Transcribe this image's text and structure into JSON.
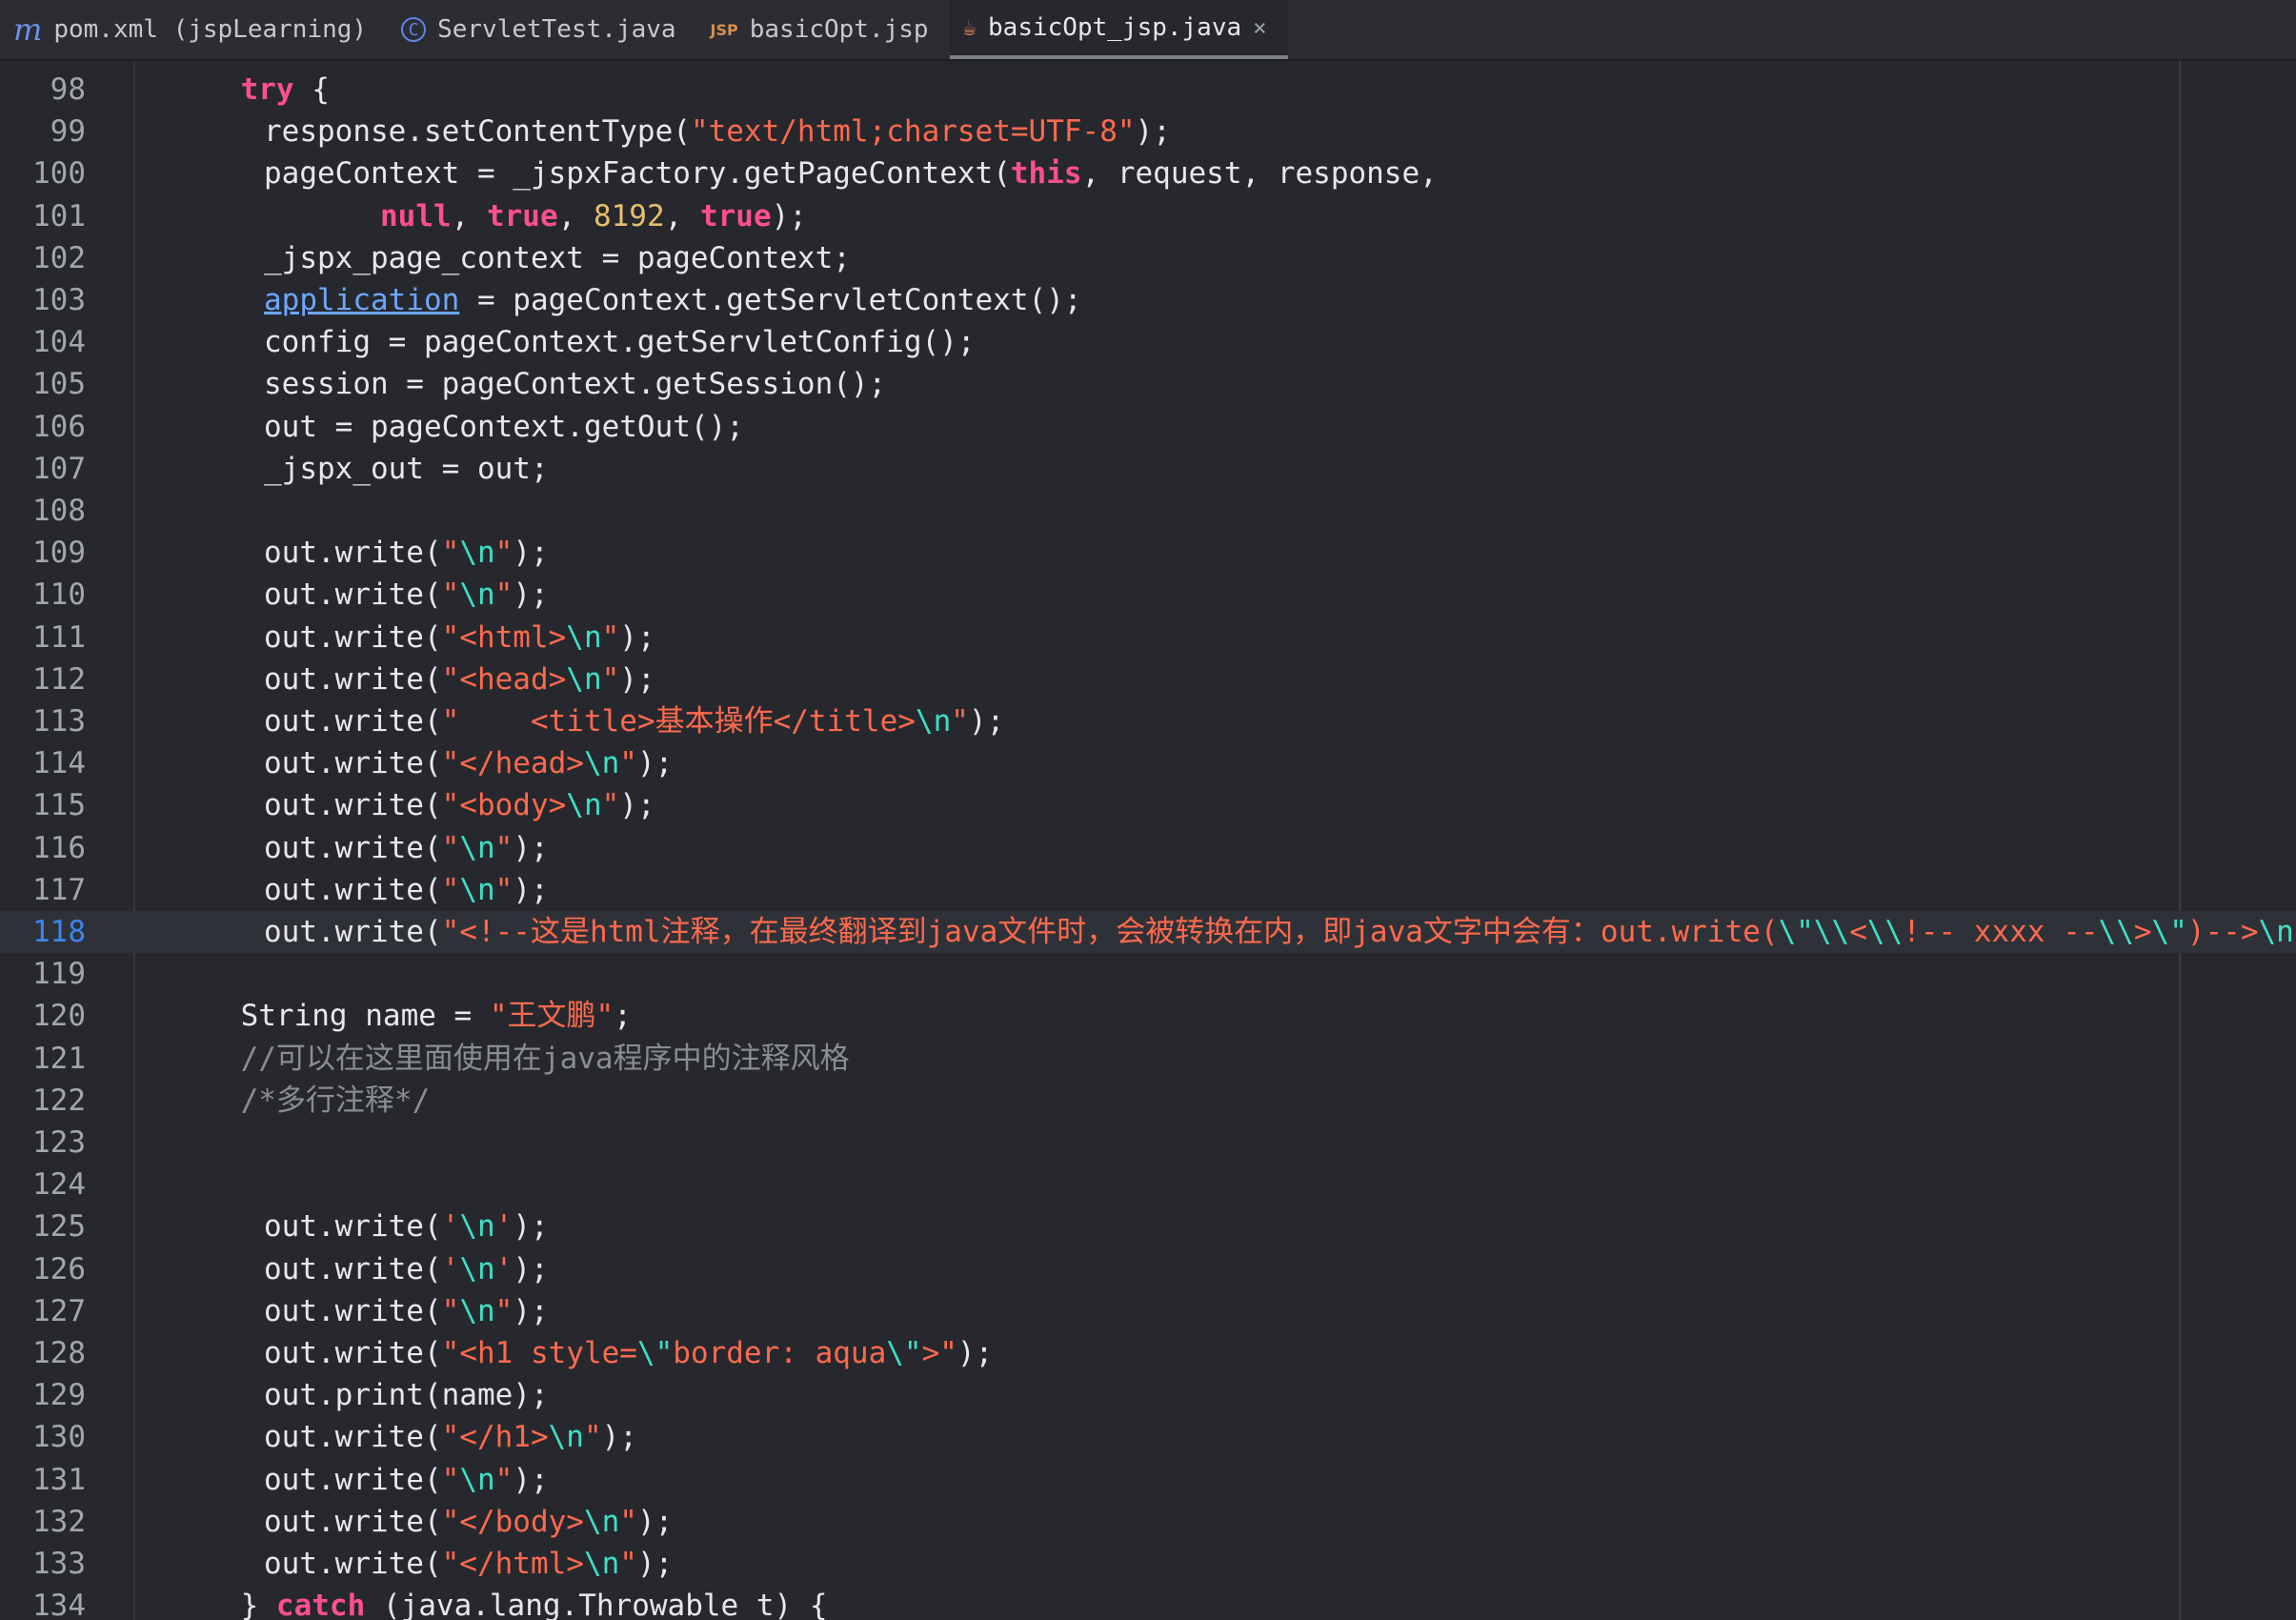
{
  "tabs": [
    {
      "icon": "maven-icon",
      "glyph": "m",
      "label": "pom.xml (jspLearning)",
      "active": false
    },
    {
      "icon": "java-class-icon",
      "glyph": "C",
      "label": "ServletTest.java",
      "active": false
    },
    {
      "icon": "jsp-file-icon",
      "glyph": "JSP",
      "label": "basicOpt.jsp",
      "active": false
    },
    {
      "icon": "java-generated-icon",
      "glyph": "☕",
      "label": "basicOpt_jsp.java",
      "active": true,
      "close_glyph": "×"
    }
  ],
  "editor": {
    "current_line": "118",
    "lines": [
      {
        "n": "98",
        "indent": 4,
        "tokens": [
          [
            "kw",
            "try"
          ],
          [
            "txt",
            " {"
          ]
        ]
      },
      {
        "n": "99",
        "indent": 5,
        "tokens": [
          [
            "txt",
            "response.setContentType("
          ],
          [
            "str",
            "\"text/html;charset=UTF-8\""
          ],
          [
            "txt",
            ");"
          ]
        ]
      },
      {
        "n": "100",
        "indent": 5,
        "tokens": [
          [
            "txt",
            "pageContext = _jspxFactory.getPageContext("
          ],
          [
            "kw",
            "this"
          ],
          [
            "txt",
            ", request, response,"
          ]
        ]
      },
      {
        "n": "101",
        "indent": 10,
        "tokens": [
          [
            "kw",
            "null"
          ],
          [
            "txt",
            ", "
          ],
          [
            "kw",
            "true"
          ],
          [
            "txt",
            ", "
          ],
          [
            "num",
            "8192"
          ],
          [
            "txt",
            ", "
          ],
          [
            "kw",
            "true"
          ],
          [
            "txt",
            ");"
          ]
        ]
      },
      {
        "n": "102",
        "indent": 5,
        "tokens": [
          [
            "txt",
            "_jspx_page_context = pageContext;"
          ]
        ]
      },
      {
        "n": "103",
        "indent": 5,
        "tokens": [
          [
            "link",
            "application"
          ],
          [
            "txt",
            " = pageContext.getServletContext();"
          ]
        ]
      },
      {
        "n": "104",
        "indent": 5,
        "tokens": [
          [
            "txt",
            "config = pageContext.getServletConfig();"
          ]
        ]
      },
      {
        "n": "105",
        "indent": 5,
        "tokens": [
          [
            "txt",
            "session = pageContext.getSession();"
          ]
        ]
      },
      {
        "n": "106",
        "indent": 5,
        "tokens": [
          [
            "txt",
            "out = pageContext.getOut();"
          ]
        ]
      },
      {
        "n": "107",
        "indent": 5,
        "tokens": [
          [
            "txt",
            "_jspx_out = out;"
          ]
        ]
      },
      {
        "n": "108",
        "indent": 0,
        "tokens": []
      },
      {
        "n": "109",
        "indent": 5,
        "tokens": [
          [
            "txt",
            "out.write("
          ],
          [
            "str",
            "\""
          ],
          [
            "esc",
            "\\n"
          ],
          [
            "str",
            "\""
          ],
          [
            "txt",
            ");"
          ]
        ]
      },
      {
        "n": "110",
        "indent": 5,
        "tokens": [
          [
            "txt",
            "out.write("
          ],
          [
            "str",
            "\""
          ],
          [
            "esc",
            "\\n"
          ],
          [
            "str",
            "\""
          ],
          [
            "txt",
            ");"
          ]
        ]
      },
      {
        "n": "111",
        "indent": 5,
        "tokens": [
          [
            "txt",
            "out.write("
          ],
          [
            "str",
            "\"<html>"
          ],
          [
            "esc",
            "\\n"
          ],
          [
            "str",
            "\""
          ],
          [
            "txt",
            ");"
          ]
        ]
      },
      {
        "n": "112",
        "indent": 5,
        "tokens": [
          [
            "txt",
            "out.write("
          ],
          [
            "str",
            "\"<head>"
          ],
          [
            "esc",
            "\\n"
          ],
          [
            "str",
            "\""
          ],
          [
            "txt",
            ");"
          ]
        ]
      },
      {
        "n": "113",
        "indent": 5,
        "tokens": [
          [
            "txt",
            "out.write("
          ],
          [
            "str",
            "\"    <title>基本操作</title>"
          ],
          [
            "esc",
            "\\n"
          ],
          [
            "str",
            "\""
          ],
          [
            "txt",
            ");"
          ]
        ]
      },
      {
        "n": "114",
        "indent": 5,
        "tokens": [
          [
            "txt",
            "out.write("
          ],
          [
            "str",
            "\"</head>"
          ],
          [
            "esc",
            "\\n"
          ],
          [
            "str",
            "\""
          ],
          [
            "txt",
            ");"
          ]
        ]
      },
      {
        "n": "115",
        "indent": 5,
        "tokens": [
          [
            "txt",
            "out.write("
          ],
          [
            "str",
            "\"<body>"
          ],
          [
            "esc",
            "\\n"
          ],
          [
            "str",
            "\""
          ],
          [
            "txt",
            ");"
          ]
        ]
      },
      {
        "n": "116",
        "indent": 5,
        "tokens": [
          [
            "txt",
            "out.write("
          ],
          [
            "str",
            "\""
          ],
          [
            "esc",
            "\\n"
          ],
          [
            "str",
            "\""
          ],
          [
            "txt",
            ");"
          ]
        ]
      },
      {
        "n": "117",
        "indent": 5,
        "tokens": [
          [
            "txt",
            "out.write("
          ],
          [
            "str",
            "\""
          ],
          [
            "esc",
            "\\n"
          ],
          [
            "str",
            "\""
          ],
          [
            "txt",
            ");"
          ]
        ]
      },
      {
        "n": "118",
        "indent": 5,
        "tokens": [
          [
            "txt",
            "out.write("
          ],
          [
            "str",
            "\"<!--这是html注释，在最终翻译到java文件时，会被转换在内，即java文字中会有：out.write("
          ],
          [
            "esc",
            "\\\"\\\\"
          ],
          [
            "str",
            "<"
          ],
          [
            "esc",
            "\\\\"
          ],
          [
            "str",
            "!-- xxxx --"
          ],
          [
            "esc",
            "\\\\"
          ],
          [
            "str",
            ">"
          ],
          [
            "esc",
            "\\\""
          ],
          [
            "str",
            ")-->"
          ],
          [
            "esc",
            "\\n"
          ],
          [
            "str",
            "\""
          ],
          [
            "txt",
            ");"
          ]
        ]
      },
      {
        "n": "119",
        "indent": 0,
        "tokens": []
      },
      {
        "n": "120",
        "indent": 4,
        "tokens": [
          [
            "txt",
            "String name = "
          ],
          [
            "str",
            "\"王文鹏\""
          ],
          [
            "txt",
            ";"
          ]
        ]
      },
      {
        "n": "121",
        "indent": 4,
        "tokens": [
          [
            "cmt",
            "//可以在这里面使用在java程序中的注释风格"
          ]
        ]
      },
      {
        "n": "122",
        "indent": 4,
        "tokens": [
          [
            "cmt",
            "/*多行注释*/"
          ]
        ]
      },
      {
        "n": "123",
        "indent": 0,
        "tokens": []
      },
      {
        "n": "124",
        "indent": 0,
        "tokens": []
      },
      {
        "n": "125",
        "indent": 5,
        "tokens": [
          [
            "txt",
            "out.write("
          ],
          [
            "str",
            "'"
          ],
          [
            "esc",
            "\\n"
          ],
          [
            "str",
            "'"
          ],
          [
            "txt",
            ");"
          ]
        ]
      },
      {
        "n": "126",
        "indent": 5,
        "tokens": [
          [
            "txt",
            "out.write("
          ],
          [
            "str",
            "'"
          ],
          [
            "esc",
            "\\n"
          ],
          [
            "str",
            "'"
          ],
          [
            "txt",
            ");"
          ]
        ]
      },
      {
        "n": "127",
        "indent": 5,
        "tokens": [
          [
            "txt",
            "out.write("
          ],
          [
            "str",
            "\""
          ],
          [
            "esc",
            "\\n"
          ],
          [
            "str",
            "\""
          ],
          [
            "txt",
            ");"
          ]
        ]
      },
      {
        "n": "128",
        "indent": 5,
        "tokens": [
          [
            "txt",
            "out.write("
          ],
          [
            "str",
            "\"<h1 style="
          ],
          [
            "esc",
            "\\\""
          ],
          [
            "str",
            "border: aqua"
          ],
          [
            "esc",
            "\\\""
          ],
          [
            "str",
            ">\""
          ],
          [
            "txt",
            ");"
          ]
        ]
      },
      {
        "n": "129",
        "indent": 5,
        "tokens": [
          [
            "txt",
            "out.print(name);"
          ]
        ]
      },
      {
        "n": "130",
        "indent": 5,
        "tokens": [
          [
            "txt",
            "out.write("
          ],
          [
            "str",
            "\"</h1>"
          ],
          [
            "esc",
            "\\n"
          ],
          [
            "str",
            "\""
          ],
          [
            "txt",
            ");"
          ]
        ]
      },
      {
        "n": "131",
        "indent": 5,
        "tokens": [
          [
            "txt",
            "out.write("
          ],
          [
            "str",
            "\""
          ],
          [
            "esc",
            "\\n"
          ],
          [
            "str",
            "\""
          ],
          [
            "txt",
            ");"
          ]
        ]
      },
      {
        "n": "132",
        "indent": 5,
        "tokens": [
          [
            "txt",
            "out.write("
          ],
          [
            "str",
            "\"</body>"
          ],
          [
            "esc",
            "\\n"
          ],
          [
            "str",
            "\""
          ],
          [
            "txt",
            ");"
          ]
        ]
      },
      {
        "n": "133",
        "indent": 5,
        "tokens": [
          [
            "txt",
            "out.write("
          ],
          [
            "str",
            "\"</html>"
          ],
          [
            "esc",
            "\\n"
          ],
          [
            "str",
            "\""
          ],
          [
            "txt",
            ");"
          ]
        ]
      },
      {
        "n": "134",
        "indent": 4,
        "tokens": [
          [
            "txt",
            "} "
          ],
          [
            "kw",
            "catch"
          ],
          [
            "txt",
            " (java.lang.Throwable t) {"
          ]
        ]
      }
    ]
  },
  "colors": {
    "background": "#26282e",
    "keyword": "#ff4f8f",
    "string": "#ff6a4d",
    "escape": "#3ce0c5",
    "number": "#e6c06b",
    "comment": "#8a8d93",
    "link": "#6ea6ff",
    "current_line_number": "#3a86f0"
  }
}
